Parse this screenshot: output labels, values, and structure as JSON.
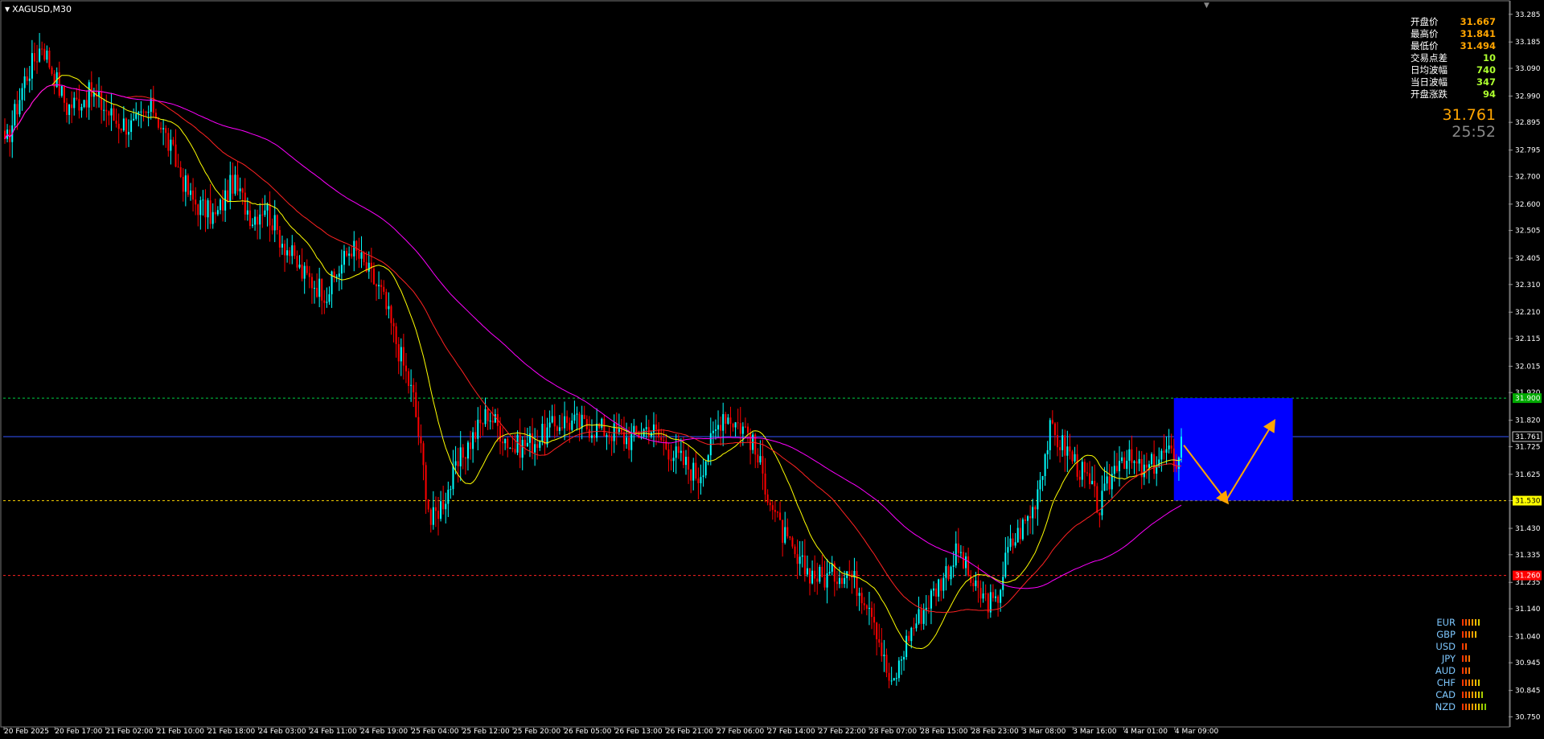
{
  "window": {
    "title": "XAGUSD,M30"
  },
  "info_panel": {
    "rows": [
      {
        "label": "开盘价",
        "value": "31.667",
        "color": "#ffa500"
      },
      {
        "label": "最高价",
        "value": "31.841",
        "color": "#ffa500"
      },
      {
        "label": "最低价",
        "value": "31.494",
        "color": "#ffa500"
      },
      {
        "label": "交易点差",
        "value": "10",
        "color": "#adff2f"
      },
      {
        "label": "日均波幅",
        "value": "740",
        "color": "#adff2f"
      },
      {
        "label": "当日波幅",
        "value": "347",
        "color": "#adff2f"
      },
      {
        "label": "开盘涨跌",
        "value": "94",
        "color": "#adff2f"
      }
    ],
    "price": "31.761",
    "countdown": "25:52"
  },
  "strength_meter": [
    {
      "name": "EUR",
      "bars": 6
    },
    {
      "name": "GBP",
      "bars": 5
    },
    {
      "name": "USD",
      "bars": 2
    },
    {
      "name": "JPY",
      "bars": 3
    },
    {
      "name": "AUD",
      "bars": 3
    },
    {
      "name": "CHF",
      "bars": 6
    },
    {
      "name": "CAD",
      "bars": 7
    },
    {
      "name": "NZD",
      "bars": 8
    }
  ],
  "colors": {
    "background": "#000000",
    "bull": "#00ffff",
    "bear": "#ff0000",
    "ma_fast": "#ffff00",
    "ma_mid": "#ff2222",
    "ma_slow": "#ff00ff",
    "axis_text": "#ffffff",
    "zone_fill": "#0000ff",
    "arrow": "#ffa500"
  },
  "chart_data": {
    "type": "candlestick",
    "symbol": "XAGUSD",
    "timeframe": "M30",
    "ylim": [
      30.78,
      33.3
    ],
    "y_ticks": [
      "33.285",
      "33.185",
      "33.090",
      "32.990",
      "32.895",
      "32.795",
      "32.700",
      "32.600",
      "32.505",
      "32.405",
      "32.310",
      "32.210",
      "32.115",
      "32.015",
      "31.920",
      "31.820",
      "31.725",
      "31.625",
      "31.530",
      "31.430",
      "31.335",
      "31.235",
      "31.140",
      "31.040",
      "30.945",
      "30.845",
      "30.750"
    ],
    "x_ticks": [
      "20 Feb 2025",
      "20 Feb 17:00",
      "21 Feb 02:00",
      "21 Feb 10:00",
      "21 Feb 18:00",
      "24 Feb 03:00",
      "24 Feb 11:00",
      "24 Feb 19:00",
      "25 Feb 04:00",
      "25 Feb 12:00",
      "25 Feb 20:00",
      "26 Feb 05:00",
      "26 Feb 13:00",
      "26 Feb 21:00",
      "27 Feb 06:00",
      "27 Feb 14:00",
      "27 Feb 22:00",
      "28 Feb 07:00",
      "28 Feb 15:00",
      "28 Feb 23:00",
      "3 Mar 08:00",
      "3 Mar 16:00",
      "4 Mar 01:00",
      "4 Mar 09:00"
    ],
    "path": [
      [
        0,
        32.8
      ],
      [
        8,
        33.05
      ],
      [
        15,
        33.18
      ],
      [
        25,
        32.95
      ],
      [
        35,
        33.0
      ],
      [
        45,
        32.9
      ],
      [
        52,
        32.88
      ],
      [
        60,
        32.95
      ],
      [
        75,
        32.62
      ],
      [
        85,
        32.55
      ],
      [
        92,
        32.68
      ],
      [
        100,
        32.55
      ],
      [
        105,
        32.6
      ],
      [
        110,
        32.5
      ],
      [
        120,
        32.35
      ],
      [
        130,
        32.28
      ],
      [
        140,
        32.45
      ],
      [
        152,
        32.28
      ],
      [
        165,
        31.9
      ],
      [
        172,
        31.45
      ],
      [
        178,
        31.55
      ],
      [
        185,
        31.7
      ],
      [
        195,
        31.85
      ],
      [
        205,
        31.72
      ],
      [
        215,
        31.75
      ],
      [
        225,
        31.82
      ],
      [
        235,
        31.8
      ],
      [
        245,
        31.78
      ],
      [
        252,
        31.75
      ],
      [
        260,
        31.8
      ],
      [
        270,
        31.7
      ],
      [
        280,
        31.62
      ],
      [
        290,
        31.85
      ],
      [
        300,
        31.78
      ],
      [
        305,
        31.65
      ],
      [
        312,
        31.45
      ],
      [
        320,
        31.3
      ],
      [
        330,
        31.25
      ],
      [
        340,
        31.28
      ],
      [
        350,
        31.15
      ],
      [
        355,
        30.95
      ],
      [
        358,
        30.85
      ],
      [
        365,
        31.05
      ],
      [
        375,
        31.2
      ],
      [
        385,
        31.35
      ],
      [
        392,
        31.2
      ],
      [
        400,
        31.15
      ],
      [
        405,
        31.35
      ],
      [
        415,
        31.5
      ],
      [
        422,
        31.78
      ],
      [
        430,
        31.7
      ],
      [
        437,
        31.6
      ],
      [
        442,
        31.5
      ],
      [
        450,
        31.7
      ],
      [
        460,
        31.63
      ],
      [
        468,
        31.7
      ],
      [
        475,
        31.67
      ]
    ],
    "moving_averages": [
      {
        "period": 20,
        "color": "#ffff00"
      },
      {
        "period": 50,
        "color": "#ff2222"
      },
      {
        "period": 100,
        "color": "#ff00ff"
      }
    ],
    "levels": [
      {
        "price": 31.9,
        "label": "31.900",
        "style": "dotted",
        "color": "#00cc44",
        "label_bg": "#00aa00"
      },
      {
        "price": 31.761,
        "label": "31.761",
        "style": "solid",
        "color": "#3355ff",
        "label_bg": "#000000"
      },
      {
        "price": 31.53,
        "label": "31.530",
        "style": "dotted",
        "color": "#ffd700",
        "label_bg": "#ffff00"
      },
      {
        "price": 31.26,
        "label": "31.260",
        "style": "dotted",
        "color": "#ff2222",
        "label_bg": "#ff0000"
      }
    ],
    "zone": {
      "price_top": 31.9,
      "price_bottom": 31.53,
      "start_bar": 472,
      "end_bar": 520
    },
    "projection": [
      [
        476,
        31.73
      ],
      [
        493,
        31.53
      ],
      [
        512,
        31.81
      ]
    ]
  }
}
